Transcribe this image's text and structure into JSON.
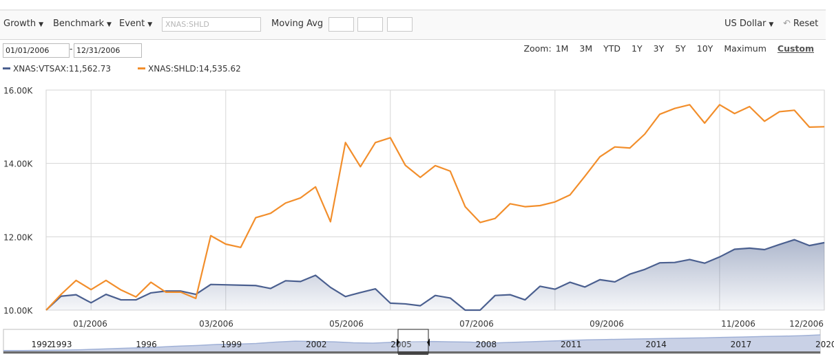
{
  "toolbar": {
    "growth": "Growth",
    "benchmark": "Benchmark",
    "event": "Event",
    "symbol_placeholder": "XNAS:SHLD",
    "moving_avg": "Moving Avg",
    "currency": "US Dollar",
    "reset": "Reset"
  },
  "dates": {
    "start": "01/01/2006",
    "separator": "-",
    "end": "12/31/2006"
  },
  "zoom": {
    "label": "Zoom:",
    "options": [
      "1M",
      "3M",
      "YTD",
      "1Y",
      "3Y",
      "5Y",
      "10Y",
      "Maximum",
      "Custom"
    ],
    "active": "Custom"
  },
  "legend": [
    {
      "label": "XNAS:VTSAX:11,562.73",
      "color": "#4a5f8f"
    },
    {
      "label": "XNAS:SHLD:14,535.62",
      "color": "#f28e2b"
    }
  ],
  "chart_data": {
    "type": "line",
    "ylim": [
      10000,
      16000
    ],
    "yticks": [
      10000,
      12000,
      14000,
      16000
    ],
    "ytick_labels": [
      "10.00K",
      "12.00K",
      "14.00K",
      "16.00K"
    ],
    "xtick_labels": [
      "01/2006",
      "03/2006",
      "05/2006",
      "07/2006",
      "09/2006",
      "11/2006",
      "12/2006"
    ],
    "xtick_index": [
      3,
      12,
      23,
      34,
      45,
      56,
      63
    ],
    "grid": true,
    "series": [
      {
        "name": "XNAS:VTSAX",
        "color": "#4a5f8f",
        "fill": true,
        "values": [
          10000,
          10380,
          10420,
          10200,
          10430,
          10280,
          10280,
          10470,
          10520,
          10520,
          10430,
          10700,
          10690,
          10680,
          10670,
          10590,
          10800,
          10780,
          10950,
          10620,
          10370,
          10480,
          10580,
          10190,
          10170,
          10120,
          10400,
          10330,
          10000,
          10000,
          10400,
          10420,
          10280,
          10650,
          10570,
          10760,
          10630,
          10830,
          10770,
          10980,
          11110,
          11290,
          11300,
          11380,
          11280,
          11450,
          11660,
          11690,
          11650,
          11790,
          11920,
          11760,
          11840
        ]
      },
      {
        "name": "XNAS:SHLD",
        "color": "#f28e2b",
        "fill": false,
        "values": [
          10000,
          10430,
          10810,
          10560,
          10810,
          10550,
          10360,
          10760,
          10490,
          10490,
          10320,
          12030,
          11800,
          11710,
          12520,
          12640,
          12920,
          13060,
          13360,
          12410,
          14570,
          13910,
          14570,
          14700,
          13950,
          13620,
          13940,
          13790,
          12820,
          12390,
          12500,
          12900,
          12820,
          12850,
          12950,
          13140,
          13650,
          14180,
          14450,
          14420,
          14800,
          15340,
          15500,
          15600,
          15100,
          15600,
          15360,
          15550,
          15150,
          15410,
          15450,
          14990,
          15000
        ]
      }
    ]
  },
  "navigator": {
    "year_labels": [
      "1992",
      "1993",
      "1996",
      "1999",
      "2002",
      "2005",
      "2008",
      "2011",
      "2014",
      "2017",
      "2020"
    ],
    "year_positions": [
      0.03,
      0.06,
      0.19,
      0.32,
      0.45,
      0.58,
      0.71,
      0.84,
      0.97,
      1.1,
      1.23
    ],
    "trend": [
      0.05,
      0.05,
      0.06,
      0.08,
      0.1,
      0.14,
      0.18,
      0.22,
      0.26,
      0.32,
      0.36,
      0.42,
      0.44,
      0.48,
      0.56,
      0.62,
      0.6,
      0.58,
      0.52,
      0.5,
      0.55,
      0.58,
      0.6,
      0.58,
      0.56,
      0.5,
      0.54,
      0.58,
      0.62,
      0.66,
      0.7,
      0.72,
      0.74,
      0.76,
      0.78,
      0.8,
      0.82,
      0.85,
      0.87,
      0.9,
      0.92,
      0.95,
      1.0
    ]
  }
}
